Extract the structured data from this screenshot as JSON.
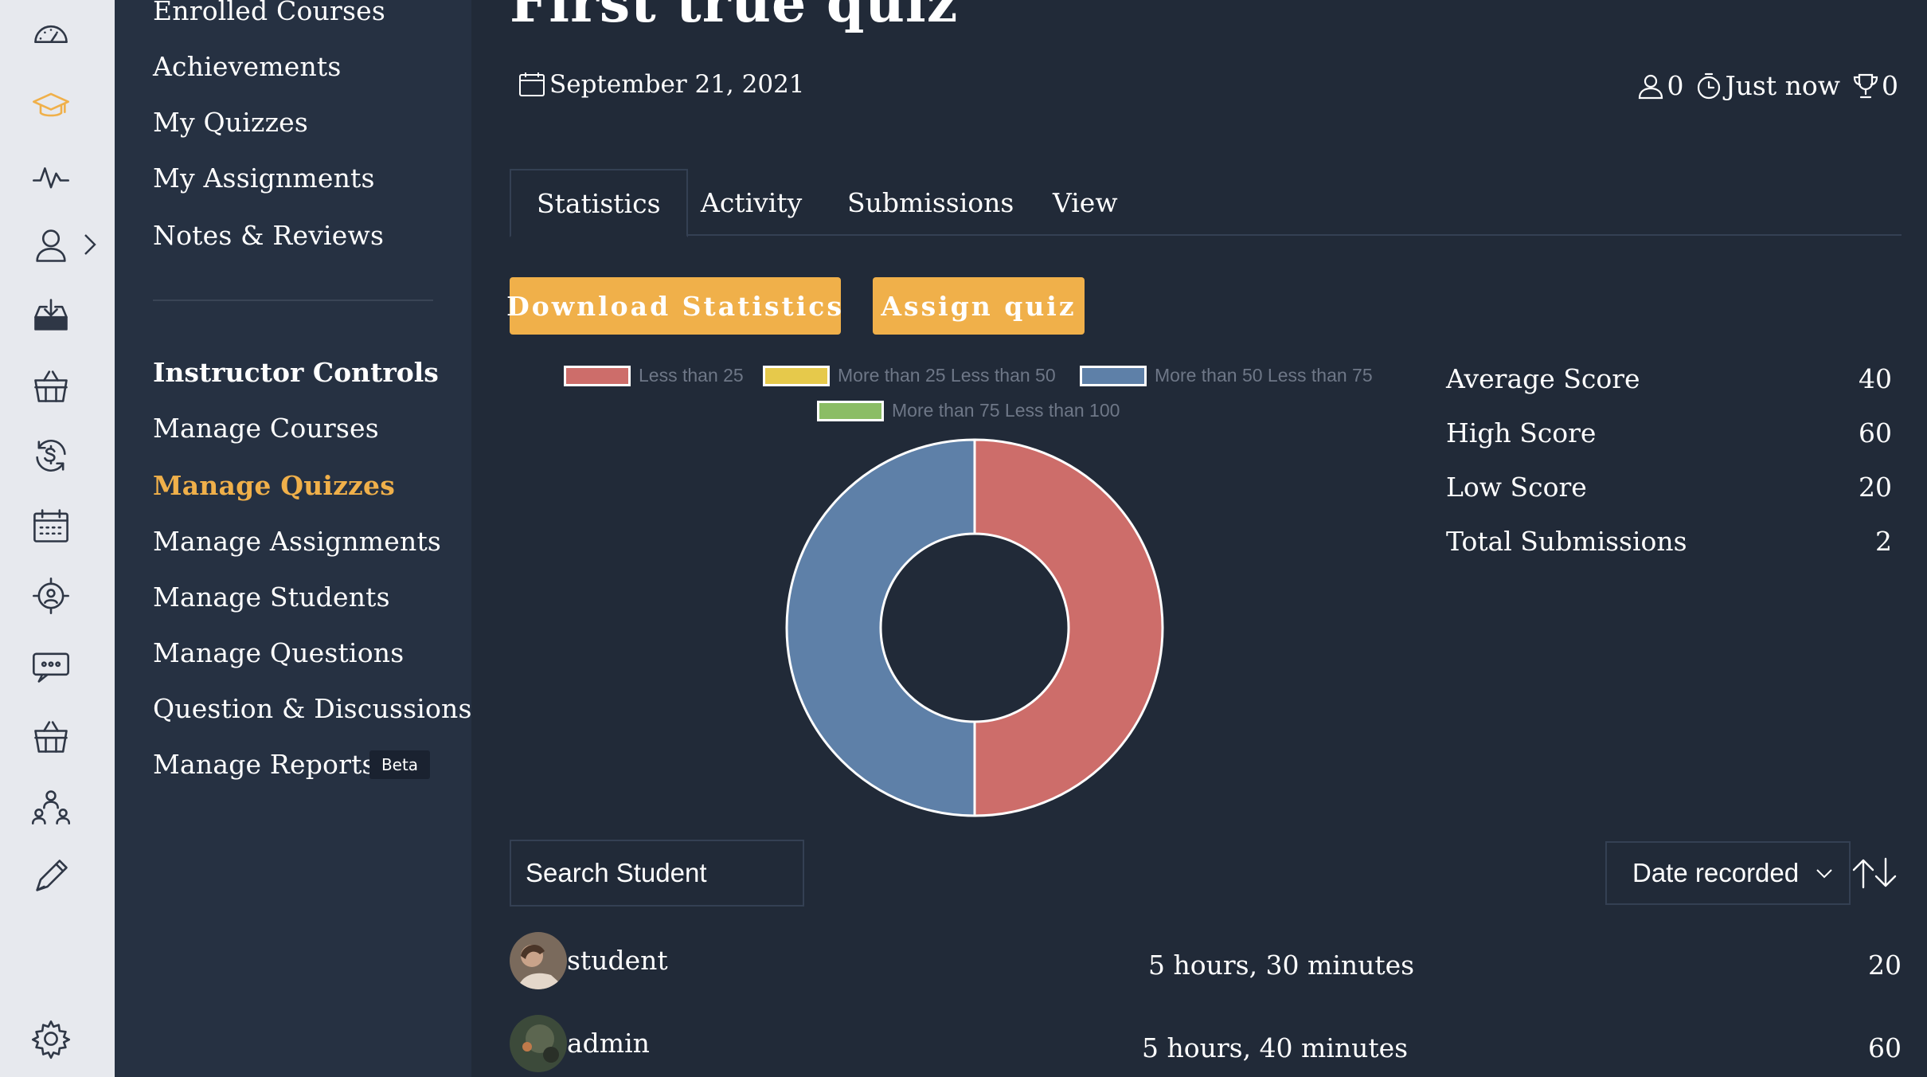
{
  "page": {
    "title": "First true quiz",
    "date": "September 21, 2021",
    "meta": {
      "attempts": "0",
      "time": "Just now",
      "trophies": "0"
    }
  },
  "rail": {
    "icons": [
      "dashboard-icon",
      "graduation-cap-icon",
      "activity-icon",
      "user-icon",
      "download-tray-icon",
      "basket-icon",
      "currency-exchange-icon",
      "calendar-grid-icon",
      "target-user-icon",
      "chat-bubble-icon",
      "basket-icon",
      "users-group-icon",
      "pencil-icon",
      "gear-icon"
    ],
    "active_index": 1
  },
  "menu": {
    "student_items": [
      "Enrolled Courses",
      "Achievements",
      "My Quizzes",
      "My Assignments",
      "Notes & Reviews"
    ],
    "instructor_heading": "Instructor Controls",
    "instructor_items": [
      "Manage Courses",
      "Manage Quizzes",
      "Manage Assignments",
      "Manage Students",
      "Manage Questions",
      "Question & Discussions",
      "Manage Reports"
    ],
    "active_item": "Manage Quizzes",
    "beta_label": "Beta"
  },
  "tabs": [
    "Statistics",
    "Activity",
    "Submissions",
    "View"
  ],
  "active_tab": "Statistics",
  "buttons": {
    "download": "Download Statistics",
    "assign": "Assign quiz"
  },
  "chart_data": {
    "type": "pie",
    "labels": [
      "Less than 25",
      "More than 25 Less than 50",
      "More than 50 Less than 75",
      "More than 75 Less than 100"
    ],
    "values": [
      1,
      0,
      1,
      0
    ],
    "colors": [
      "#cd6d6a",
      "#e6c94b",
      "#5e80a8",
      "#8bbd65"
    ],
    "donut": true,
    "legend_position": "top"
  },
  "stats": [
    {
      "label": "Average Score",
      "value": "40"
    },
    {
      "label": "High Score",
      "value": "60"
    },
    {
      "label": "Low Score",
      "value": "20"
    },
    {
      "label": "Total Submissions",
      "value": "2"
    }
  ],
  "search": {
    "placeholder": "Search Student"
  },
  "sort": {
    "selected": "Date recorded"
  },
  "submissions": [
    {
      "name": "student",
      "time": "5 hours, 30 minutes",
      "score": "20"
    },
    {
      "name": "admin",
      "time": "5 hours, 40 minutes",
      "score": "60"
    }
  ],
  "colors": {
    "accent": "#f0b04a",
    "background": "#212a38",
    "sidebar": "#263142",
    "rail": "#e7e9ee"
  }
}
